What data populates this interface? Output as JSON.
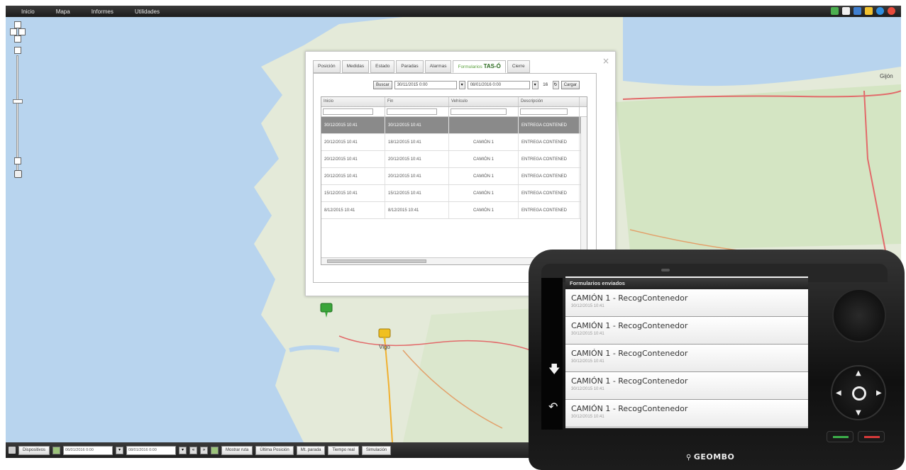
{
  "topbar": {
    "menu": [
      "Inicio",
      "Mapa",
      "Informes",
      "Utilidades"
    ],
    "tool_colors": [
      "#4caf50",
      "#f0f0f0",
      "#3f7fd0",
      "#f2c230",
      "#2f8ee0",
      "#e84a3a"
    ]
  },
  "map": {
    "places": [
      "Gijón",
      "Vigo"
    ],
    "marker_colors": {
      "green": "#3aa53a",
      "yellow": "#f0c020"
    }
  },
  "dialog": {
    "tabs": [
      "Posición",
      "Medidas",
      "Estado",
      "Paradas",
      "Alarmas",
      "Formularios TAS-Ó",
      "Cierre"
    ],
    "active_tab": "Formularios TAS-Ó",
    "active_tab_prefix": "Formularios",
    "active_tab_brand": "TAS-Ó",
    "filter": {
      "button_label": "Buscar",
      "date_from": "30/11/2015 0:00",
      "date_to": "08/01/2016 0:00",
      "count": "16",
      "export_label": "Cargar"
    },
    "grid": {
      "columns": [
        "Inicio",
        "Fin",
        "Vehículo",
        "Descripción"
      ],
      "rows": [
        [
          "30/12/2015 10:41",
          "30/12/2015 10:41",
          "",
          "ENTREGA CONTENED"
        ],
        [
          "20/12/2015 10:41",
          "18/12/2015 10:41",
          "CAMIÓN 1",
          "ENTREGA CONTENED"
        ],
        [
          "20/12/2015 10:41",
          "20/12/2015 10:41",
          "CAMIÓN 1",
          "ENTREGA CONTENED"
        ],
        [
          "20/12/2015 10:41",
          "20/12/2015 10:41",
          "CAMIÓN 1",
          "ENTREGA CONTENED"
        ],
        [
          "15/12/2015 10:41",
          "15/12/2015 10:41",
          "CAMIÓN 1",
          "ENTREGA CONTENED"
        ],
        [
          "8/12/2015 10:41",
          "8/12/2015 10:41",
          "CAMIÓN 1",
          "ENTREGA CONTENED"
        ]
      ],
      "selected_row": 0
    }
  },
  "bottombar": {
    "devices_label": "Dispositivos",
    "date_from": "06/01/2016 0:00",
    "date_to": "08/01/2016 0:00",
    "buttons": [
      "Mostrar ruta",
      "Última Posición",
      "Mt. parada",
      "Tiempo real",
      "Simulación"
    ]
  },
  "device": {
    "screen_title": "Formularios enviados",
    "items": [
      {
        "title": "CAMIÓN 1 - RecogContenedor",
        "date": "30/12/2015 10:41"
      },
      {
        "title": "CAMIÓN 1 - RecogContenedor",
        "date": "30/12/2015 10:41"
      },
      {
        "title": "CAMIÓN 1 - RecogContenedor",
        "date": "30/12/2015 10:41"
      },
      {
        "title": "CAMIÓN 1 - RecogContenedor",
        "date": "30/12/2015 10:41"
      },
      {
        "title": "CAMIÓN 1 - RecogContenedor",
        "date": "30/12/2015 10:41"
      }
    ],
    "brand": "GEOMBO",
    "buttons": {
      "ok_color": "#3cae4a",
      "cancel_color": "#d63a3a"
    }
  }
}
